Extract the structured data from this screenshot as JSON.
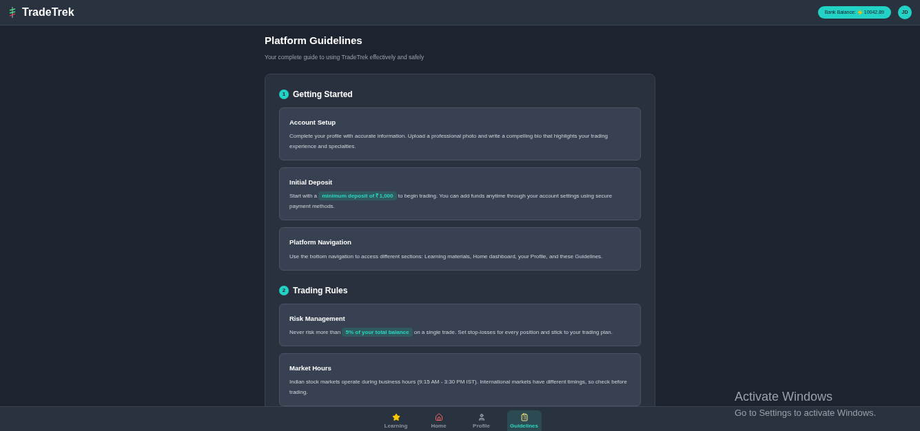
{
  "header": {
    "brand": "TradeTrek",
    "balance_label": "Bank Balance:",
    "balance_value": "10042.89",
    "avatar": "JD"
  },
  "page": {
    "title": "Platform Guidelines",
    "subtitle": "Your complete guide to using TradeTrek effectively and safely"
  },
  "sections": [
    {
      "number": "1",
      "title": "Getting Started",
      "items": [
        {
          "title": "Account Setup",
          "parts": [
            {
              "kind": "text",
              "text": "Complete your profile with accurate information. Upload a professional photo and write a compelling bio that highlights your trading experience and specialties."
            }
          ]
        },
        {
          "title": "Initial Deposit",
          "parts": [
            {
              "kind": "text",
              "text": "Start with a"
            },
            {
              "kind": "highlight",
              "text": "minimum deposit of ₹1,000"
            },
            {
              "kind": "text",
              "text": "to begin trading. You can add funds anytime through your account settings using secure payment methods."
            }
          ]
        },
        {
          "title": "Platform Navigation",
          "parts": [
            {
              "kind": "text",
              "text": "Use the bottom navigation to access different sections: Learning materials, Home dashboard, your Profile, and these Guidelines."
            }
          ]
        }
      ]
    },
    {
      "number": "2",
      "title": "Trading Rules",
      "items": [
        {
          "title": "Risk Management",
          "parts": [
            {
              "kind": "text",
              "text": "Never risk more than"
            },
            {
              "kind": "highlight",
              "text": "5% of your total balance"
            },
            {
              "kind": "text",
              "text": "on a single trade. Set stop-losses for every position and stick to your trading plan."
            }
          ]
        },
        {
          "title": "Market Hours",
          "parts": [
            {
              "kind": "text",
              "text": "Indian stock markets operate during business hours (9:15 AM - 3:30 PM IST). International markets have different timings, so check before trading."
            }
          ]
        }
      ]
    }
  ],
  "bottom_nav": [
    {
      "label": "Learning",
      "kind": "star",
      "selected": false
    },
    {
      "label": "Home",
      "kind": "home",
      "selected": false
    },
    {
      "label": "Profile",
      "kind": "user",
      "selected": false
    },
    {
      "label": "Guidelines",
      "kind": "clipboard",
      "selected": true
    }
  ],
  "os_overlay": {
    "title": "Activate Windows",
    "message": "Go to Settings to activate Windows."
  }
}
